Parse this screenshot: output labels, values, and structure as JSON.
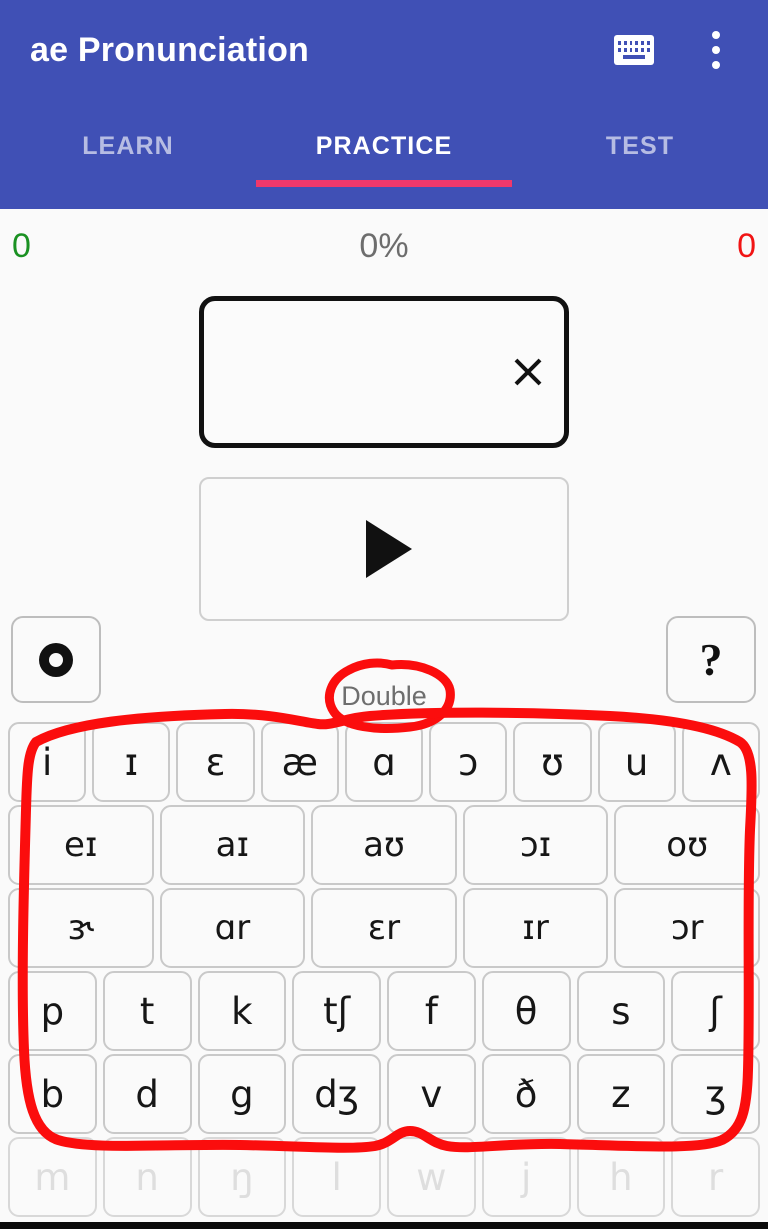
{
  "appbar": {
    "title": "ae Pronunciation",
    "keyboard_icon": "keyboard-icon",
    "overflow_icon": "more-vertical-icon"
  },
  "tabs": [
    {
      "label": "LEARN",
      "active": false
    },
    {
      "label": "PRACTICE",
      "active": true
    },
    {
      "label": "TEST",
      "active": false
    }
  ],
  "stats": {
    "correct": "0",
    "percent": "0%",
    "wrong": "0",
    "correct_color": "#1a9122",
    "percent_color": "#6d6d6d",
    "wrong_color": "#f11414"
  },
  "answer": {
    "value": "",
    "clear_icon": "close-icon"
  },
  "play": {
    "icon": "play-icon"
  },
  "controls": {
    "settings_icon": "gear-icon",
    "help_label": "?"
  },
  "mode_label": "Double",
  "keyboard": {
    "rows": [
      {
        "name": "vowels-monophthong",
        "keys": [
          "i",
          "ɪ",
          "ɛ",
          "æ",
          "ɑ",
          "ɔ",
          "ʊ",
          "u",
          "ʌ"
        ],
        "disabled": false
      },
      {
        "name": "vowels-diphthong",
        "keys": [
          "eɪ",
          "aɪ",
          "aʊ",
          "ɔɪ",
          "oʊ"
        ],
        "disabled": false
      },
      {
        "name": "vowels-rhotic",
        "keys": [
          "ɝ",
          "ɑr",
          "ɛr",
          "ɪr",
          "ɔr"
        ],
        "disabled": false
      },
      {
        "name": "consonants-voiceless",
        "keys": [
          "p",
          "t",
          "k",
          "tʃ",
          "f",
          "θ",
          "s",
          "ʃ"
        ],
        "disabled": false
      },
      {
        "name": "consonants-voiced",
        "keys": [
          "b",
          "d",
          "g",
          "dʒ",
          "v",
          "ð",
          "z",
          "ʒ"
        ],
        "disabled": false
      },
      {
        "name": "consonants-sonorant",
        "keys": [
          "m",
          "n",
          "ŋ",
          "l",
          "w",
          "j",
          "h",
          "r"
        ],
        "disabled": true
      }
    ]
  },
  "annotations": {
    "color": "#fb0d0d",
    "items": [
      {
        "name": "annotation-circle-double",
        "shape": "ellipse"
      },
      {
        "name": "annotation-outline-keyboard",
        "shape": "rounded-rect"
      }
    ]
  },
  "theme": {
    "appbar_blue": "#4050b5",
    "tab_indicator_pink": "#f0386b",
    "page_background": "#fafafa",
    "key_border": "#c9c9c9"
  }
}
